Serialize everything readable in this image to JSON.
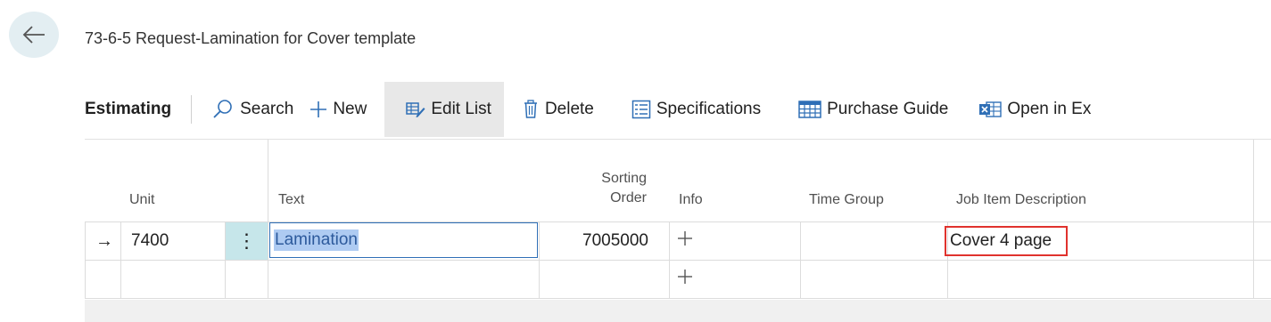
{
  "page": {
    "title": "73-6-5 Request-Lamination for Cover template"
  },
  "actionbar": {
    "title": "Estimating",
    "search_label": "Search",
    "new_label": "New",
    "edit_list_label": "Edit List",
    "delete_label": "Delete",
    "specifications_label": "Specifications",
    "purchase_guide_label": "Purchase Guide",
    "open_in_excel_label": "Open in Ex"
  },
  "grid": {
    "columns": {
      "unit": "Unit",
      "text": "Text",
      "sorting_order_line1": "Sorting",
      "sorting_order_line2": "Order",
      "info": "Info",
      "time_group": "Time Group",
      "job_item_description": "Job Item Description"
    },
    "rows": [
      {
        "indicator": "→",
        "unit": "7400",
        "menu": "⋮",
        "text": "Lamination",
        "sorting_order": "7005000",
        "info": "+",
        "time_group": "",
        "job_item_description": "Cover 4 page"
      },
      {
        "indicator": "",
        "unit": "",
        "menu": "",
        "text": "",
        "sorting_order": "",
        "info": "+",
        "time_group": "",
        "job_item_description": ""
      }
    ]
  },
  "colors": {
    "accent": "#2f6fb6",
    "selection": "#aecbf2",
    "highlight_border": "#e0322d",
    "row_menu_bg": "#c6e6ea"
  }
}
